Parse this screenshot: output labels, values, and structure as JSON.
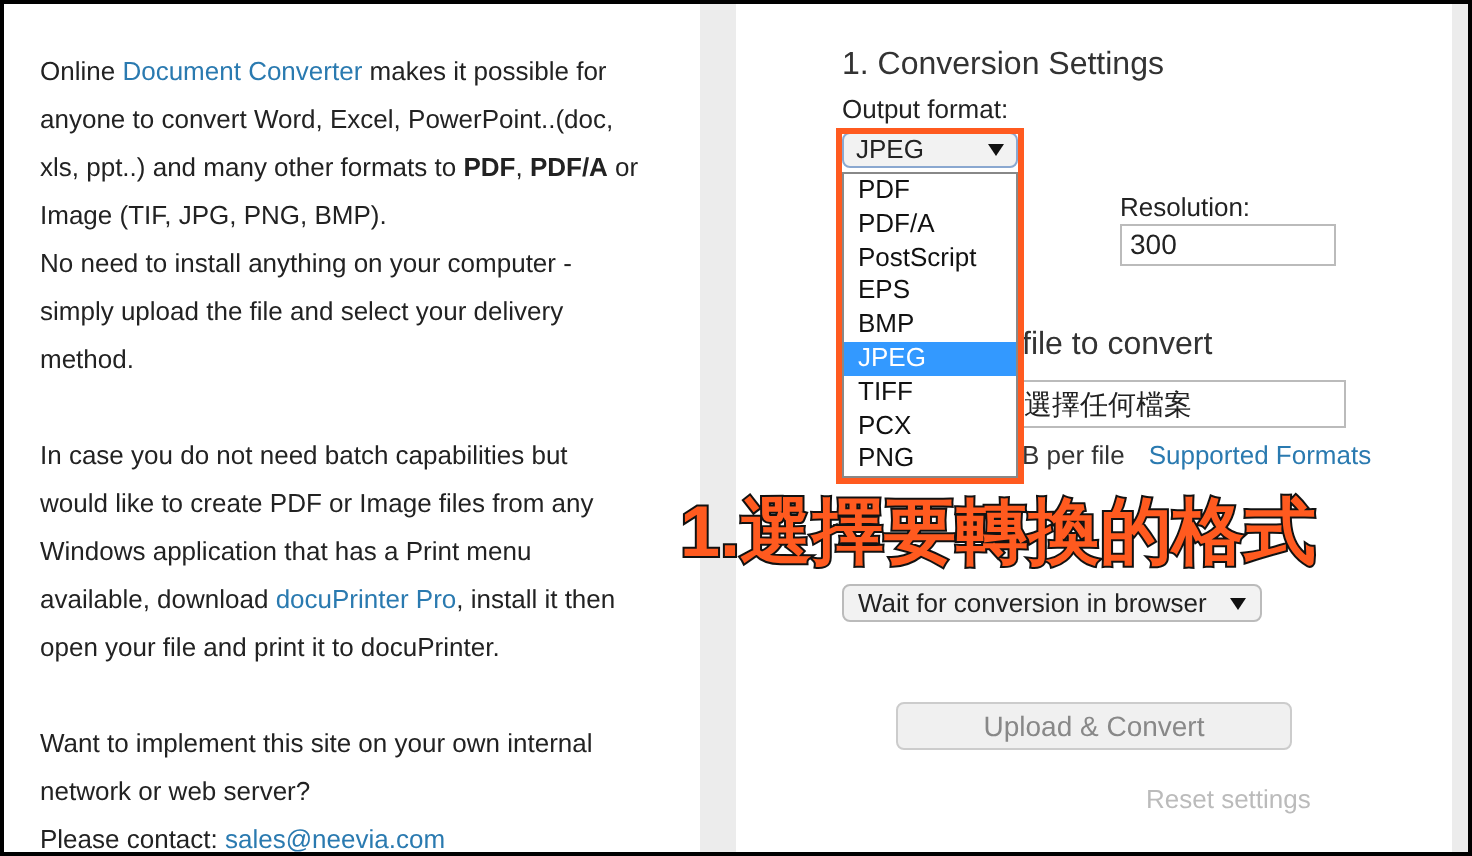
{
  "intro": {
    "blocks": [
      [
        {
          "parts": [
            {
              "kind": "text",
              "text": "Online "
            },
            {
              "kind": "link",
              "text": "Document Converter"
            },
            {
              "kind": "text",
              "text": " makes it possible for anyone to convert Word, Excel, PowerPoint..(doc, xls, ppt..) and many other formats to **PDF**, **PDF/A** or Image (TIF, JPG, PNG, BMP)."
            }
          ]
        },
        {
          "parts": [
            {
              "kind": "text",
              "text": "No need to install anything on your computer - simply upload the file and select your delivery method."
            }
          ]
        }
      ],
      [
        {
          "parts": [
            {
              "kind": "text",
              "text": "In case you do not need batch capabilities but would like to create PDF or Image files from any Windows application that has a Print menu available, download "
            },
            {
              "kind": "link",
              "text": "docuPrinter Pro"
            },
            {
              "kind": "text",
              "text": ", install it then open your file and print it to docuPrinter."
            }
          ]
        }
      ],
      [
        {
          "parts": [
            {
              "kind": "text",
              "text": "Want to implement this site on your own internal network or web server?"
            }
          ]
        },
        {
          "parts": [
            {
              "kind": "text",
              "text": "Please contact: "
            },
            {
              "kind": "link",
              "text": "sales@neevia.com"
            }
          ]
        }
      ]
    ]
  },
  "settings": {
    "heading": "1. Conversion Settings",
    "output_format": {
      "label": "Output format:",
      "value": "JPEG",
      "expanded": true,
      "options": [
        {
          "label": "PDF",
          "selected": false
        },
        {
          "label": "PDF/A",
          "selected": false
        },
        {
          "label": "PostScript",
          "selected": false
        },
        {
          "label": "EPS",
          "selected": false
        },
        {
          "label": "BMP",
          "selected": false
        },
        {
          "label": "JPEG",
          "selected": true
        },
        {
          "label": "TIFF",
          "selected": false
        },
        {
          "label": "PCX",
          "selected": false
        },
        {
          "label": "PNG",
          "selected": false
        }
      ]
    },
    "resolution": {
      "label": "Resolution:",
      "value": "300"
    }
  },
  "file_section": {
    "heading": "file to convert",
    "file_field": "選擇任何檔案",
    "size_note": "B per file",
    "formats_link": "Supported Formats"
  },
  "delivery": {
    "value": "Wait for conversion in browser"
  },
  "upload_button": "Upload & Convert",
  "reset_link": "Reset settings",
  "annotation": "1.選擇要轉換的格式"
}
